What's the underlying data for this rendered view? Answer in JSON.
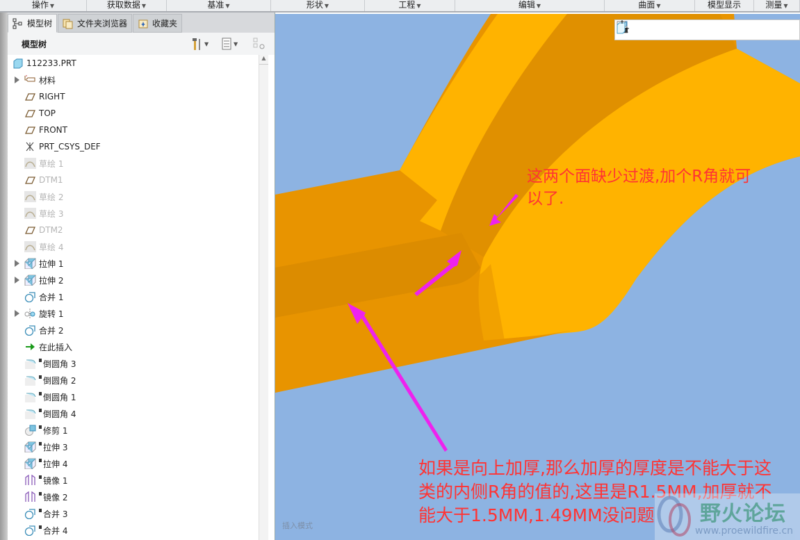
{
  "menubar": [
    "操作",
    "获取数据",
    "基准",
    "形状",
    "工程",
    "编辑",
    "曲面",
    "模型显示",
    "测量"
  ],
  "tabs": {
    "model_tree": "模型树",
    "folder_browser": "文件夹浏览器",
    "favorites": "收藏夹"
  },
  "tree_header": {
    "title": "模型树"
  },
  "tree": [
    {
      "label": "112233.PRT",
      "icon": "part-icon",
      "expand": false,
      "dim": false,
      "marker": false,
      "root": true
    },
    {
      "label": "材料",
      "icon": "material-tag-icon",
      "expand": true,
      "dim": false,
      "marker": false
    },
    {
      "label": "RIGHT",
      "icon": "datum-plane-icon",
      "expand": false,
      "dim": false,
      "marker": false
    },
    {
      "label": "TOP",
      "icon": "datum-plane-icon",
      "expand": false,
      "dim": false,
      "marker": false
    },
    {
      "label": "FRONT",
      "icon": "datum-plane-icon",
      "expand": false,
      "dim": false,
      "marker": false
    },
    {
      "label": "PRT_CSYS_DEF",
      "icon": "csys-icon",
      "expand": false,
      "dim": false,
      "marker": false
    },
    {
      "label": "草绘 1",
      "icon": "sketch-icon",
      "expand": false,
      "dim": true,
      "marker": false
    },
    {
      "label": "DTM1",
      "icon": "datum-plane-icon",
      "expand": false,
      "dim": true,
      "marker": false
    },
    {
      "label": "草绘 2",
      "icon": "sketch-icon",
      "expand": false,
      "dim": true,
      "marker": false
    },
    {
      "label": "草绘 3",
      "icon": "sketch-icon",
      "expand": false,
      "dim": true,
      "marker": false
    },
    {
      "label": "DTM2",
      "icon": "datum-plane-icon",
      "expand": false,
      "dim": true,
      "marker": false
    },
    {
      "label": "草绘 4",
      "icon": "sketch-icon",
      "expand": false,
      "dim": true,
      "marker": false
    },
    {
      "label": "拉伸 1",
      "icon": "extrude-icon",
      "expand": true,
      "dim": false,
      "marker": false
    },
    {
      "label": "拉伸 2",
      "icon": "extrude-icon",
      "expand": true,
      "dim": false,
      "marker": false
    },
    {
      "label": "合并 1",
      "icon": "merge-icon",
      "expand": false,
      "dim": false,
      "marker": false
    },
    {
      "label": "旋转 1",
      "icon": "revolve-icon",
      "expand": true,
      "dim": false,
      "marker": false
    },
    {
      "label": "合并 2",
      "icon": "merge-icon",
      "expand": false,
      "dim": false,
      "marker": false
    },
    {
      "label": "在此插入",
      "icon": "insert-here-arrow-icon",
      "expand": false,
      "dim": false,
      "marker": false
    },
    {
      "label": "倒圆角 3",
      "icon": "round-icon",
      "expand": false,
      "dim": false,
      "marker": true
    },
    {
      "label": "倒圆角 2",
      "icon": "round-icon",
      "expand": false,
      "dim": false,
      "marker": true
    },
    {
      "label": "倒圆角 1",
      "icon": "round-icon",
      "expand": false,
      "dim": false,
      "marker": true
    },
    {
      "label": "倒圆角 4",
      "icon": "round-icon",
      "expand": false,
      "dim": false,
      "marker": true
    },
    {
      "label": "修剪 1",
      "icon": "trim-icon",
      "expand": false,
      "dim": false,
      "marker": true
    },
    {
      "label": "拉伸 3",
      "icon": "extrude-icon",
      "expand": false,
      "dim": false,
      "marker": true
    },
    {
      "label": "拉伸 4",
      "icon": "extrude-icon",
      "expand": false,
      "dim": false,
      "marker": true
    },
    {
      "label": "镜像 1",
      "icon": "mirror-icon",
      "expand": false,
      "dim": false,
      "marker": true
    },
    {
      "label": "镜像 2",
      "icon": "mirror-icon",
      "expand": false,
      "dim": false,
      "marker": true
    },
    {
      "label": "合并 3",
      "icon": "merge-icon",
      "expand": false,
      "dim": false,
      "marker": true
    },
    {
      "label": "合并 4",
      "icon": "merge-icon",
      "expand": false,
      "dim": false,
      "marker": true
    }
  ],
  "view_toolbar": [
    "refit-icon",
    "zoom-in-icon",
    "zoom-out-icon",
    "repaint-icon",
    "display-style-icon",
    "saved-views-icon",
    "view-manager-icon",
    "snapshot-icon",
    "spin-center-icon",
    "datum-display-icon"
  ],
  "viewport": {
    "annotation_top": [
      "这两个面缺少过渡,加个R角就可",
      "以了."
    ],
    "annotation_bottom": [
      "如果是向上加厚,那么加厚的厚度是不能大于这",
      "类的内侧R角的值的,这里是R1.5MM,加厚就不",
      "能大于1.5MM,1.49MM没问题"
    ],
    "mode_text": "插入模式",
    "watermark": {
      "title": "野火论坛",
      "url": "www.proewildfire.cn"
    }
  },
  "colors": {
    "background": "#8db3e2",
    "part": "#e89400",
    "annotation": "#ff3333",
    "arrow": "#ee22ee"
  }
}
